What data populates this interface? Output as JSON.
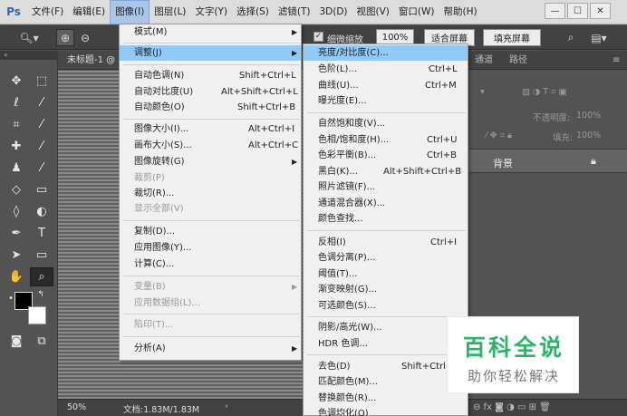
{
  "app": {
    "logo": "Ps"
  },
  "menubar": {
    "items": [
      "文件(F)",
      "编辑(E)",
      "图像(I)",
      "图层(L)",
      "文字(Y)",
      "选择(S)",
      "滤镜(T)",
      "3D(D)",
      "视图(V)",
      "窗口(W)",
      "帮助(H)"
    ],
    "active_index": 2
  },
  "window_controls": {
    "minimize": "—",
    "restore": "☐",
    "close": "✕"
  },
  "options_bar": {
    "checkbox_label": "细微缩放",
    "zoom_value": "100%",
    "fit_screen_label": "适合屏幕",
    "fill_screen_label": "填充屏幕"
  },
  "document": {
    "tab_title": "未标题-1 @"
  },
  "status_bar": {
    "zoom": "50%",
    "doc_info": "文档:1.83M/1.83M",
    "arrow": "›"
  },
  "right_panel": {
    "tabs": [
      "通道",
      "路径"
    ],
    "opacity_label": "不透明度:",
    "opacity_value": "100%",
    "fill_label": "填充:",
    "fill_value": "100%",
    "layer_name": "背景"
  },
  "image_menu": {
    "items": [
      {
        "label": "模式(M)",
        "shortcut": "",
        "submenu": true,
        "disabled": false
      },
      {
        "label": "调整(J)",
        "shortcut": "",
        "submenu": true,
        "disabled": false,
        "highlighted": true
      },
      {
        "label": "自动色调(N)",
        "shortcut": "Shift+Ctrl+L"
      },
      {
        "label": "自动对比度(U)",
        "shortcut": "Alt+Shift+Ctrl+L"
      },
      {
        "label": "自动颜色(O)",
        "shortcut": "Shift+Ctrl+B"
      },
      {
        "label": "图像大小(I)...",
        "shortcut": "Alt+Ctrl+I"
      },
      {
        "label": "画布大小(S)...",
        "shortcut": "Alt+Ctrl+C"
      },
      {
        "label": "图像旋转(G)",
        "shortcut": "",
        "submenu": true
      },
      {
        "label": "裁剪(P)",
        "shortcut": "",
        "disabled": true
      },
      {
        "label": "裁切(R)...",
        "shortcut": ""
      },
      {
        "label": "显示全部(V)",
        "shortcut": "",
        "disabled": true
      },
      {
        "label": "复制(D)...",
        "shortcut": ""
      },
      {
        "label": "应用图像(Y)...",
        "shortcut": ""
      },
      {
        "label": "计算(C)...",
        "shortcut": ""
      },
      {
        "label": "变量(B)",
        "shortcut": "",
        "submenu": true,
        "disabled": true
      },
      {
        "label": "应用数据组(L)...",
        "shortcut": "",
        "disabled": true
      },
      {
        "label": "陷印(T)...",
        "shortcut": "",
        "disabled": true
      },
      {
        "label": "分析(A)",
        "shortcut": "",
        "submenu": true
      }
    ]
  },
  "adjust_menu": {
    "items": [
      {
        "label": "亮度/对比度(C)...",
        "shortcut": "",
        "highlighted": true
      },
      {
        "label": "色阶(L)...",
        "shortcut": "Ctrl+L"
      },
      {
        "label": "曲线(U)...",
        "shortcut": "Ctrl+M"
      },
      {
        "label": "曝光度(E)...",
        "shortcut": ""
      },
      {
        "label": "自然饱和度(V)...",
        "shortcut": ""
      },
      {
        "label": "色相/饱和度(H)...",
        "shortcut": "Ctrl+U"
      },
      {
        "label": "色彩平衡(B)...",
        "shortcut": "Ctrl+B"
      },
      {
        "label": "黑白(K)...",
        "shortcut": "Alt+Shift+Ctrl+B"
      },
      {
        "label": "照片滤镜(F)...",
        "shortcut": ""
      },
      {
        "label": "通道混合器(X)...",
        "shortcut": ""
      },
      {
        "label": "颜色查找...",
        "shortcut": ""
      },
      {
        "label": "反相(I)",
        "shortcut": "Ctrl+I"
      },
      {
        "label": "色调分离(P)...",
        "shortcut": ""
      },
      {
        "label": "阈值(T)...",
        "shortcut": ""
      },
      {
        "label": "渐变映射(G)...",
        "shortcut": ""
      },
      {
        "label": "可选颜色(S)...",
        "shortcut": ""
      },
      {
        "label": "阴影/高光(W)...",
        "shortcut": ""
      },
      {
        "label": "HDR 色调...",
        "shortcut": ""
      },
      {
        "label": "去色(D)",
        "shortcut": "Shift+Ctrl+"
      },
      {
        "label": "匹配颜色(M)...",
        "shortcut": ""
      },
      {
        "label": "替换颜色(R)...",
        "shortcut": ""
      },
      {
        "label": "色调均化(Q)",
        "shortcut": ""
      }
    ]
  },
  "watermark": {
    "title": "百科全说",
    "subtitle": "助你轻松解决"
  },
  "colors": {
    "menu_highlight": "#91c9f7",
    "menubar_active": "#a9c6ea",
    "watermark_green": "#2db36a"
  }
}
